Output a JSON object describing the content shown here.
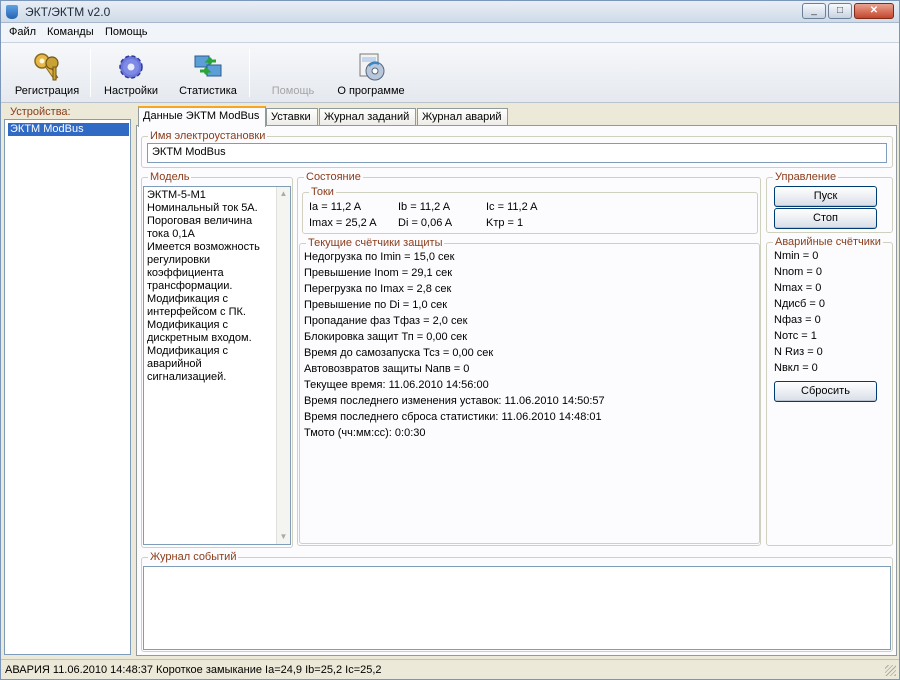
{
  "window": {
    "title": "ЭКТ/ЭКТМ v2.0"
  },
  "window_controls": {
    "minimize": "_",
    "maximize": "□",
    "close": "✕"
  },
  "menu": [
    "Файл",
    "Команды",
    "Помощь"
  ],
  "toolbar": {
    "items": [
      {
        "label": "Регистрация",
        "icon": "keys-icon",
        "enabled": true
      },
      {
        "label": "Настройки",
        "icon": "gear-icon",
        "enabled": true
      },
      {
        "label": "Статистика",
        "icon": "network-icon",
        "enabled": true
      },
      {
        "label": "Помощь",
        "icon": "help-icon",
        "enabled": false
      },
      {
        "label": "О программе",
        "icon": "about-icon",
        "enabled": true
      }
    ]
  },
  "devices": {
    "label": "Устройства:",
    "items": [
      "ЭКТМ ModBus"
    ]
  },
  "tabs": [
    "Данные ЭКТМ ModBus",
    "Уставки",
    "Журнал заданий",
    "Журнал аварий"
  ],
  "install_name": {
    "label": "Имя электроустановки",
    "value": "ЭКТМ ModBus"
  },
  "model": {
    "label": "Модель",
    "text": "ЭКТМ-5-М1\nНоминальный ток 5А.\nПороговая величина\nтока 0,1А\nИмеется возможность\nрегулировки\nкоэффициента\nтрансформации.\nМодификация с\nинтерфейсом с ПК.\nМодификация с\nдискретным входом.\nМодификация с\nаварийной\nсигнализацией."
  },
  "state": {
    "label": "Состояние",
    "currents": {
      "label": "Токи",
      "ia": "Ia = 11,2 A",
      "ib": "Ib = 11,2 A",
      "ic": "Ic = 11,2 A",
      "imax": "Imax = 25,2 A",
      "di": "Di = 0,06 A",
      "ktr": "Kтр = 1"
    },
    "counters": {
      "label": "Текущие счётчики защиты",
      "lines": [
        "Недогрузка по Imin = 15,0 сек",
        "Превышение Inom = 29,1 сек",
        "Перегрузка по Imax = 2,8 сек",
        "Превышение по Di = 1,0 сек",
        "Пропадание фаз Тфаз = 2,0 сек",
        "Блокировка защит Тп = 0,00 сек",
        "Время до самозапуска Тсз = 0,00 сек",
        "Автовозвратов защиты Nапв = 0",
        "Текущее время: 11.06.2010 14:56:00",
        "Время последнего изменения уставок: 11.06.2010 14:50:57",
        "Время последнего сброса статистики: 11.06.2010 14:48:01",
        "Тмото (чч:мм:сс): 0:0:30"
      ]
    }
  },
  "control": {
    "label": "Управление",
    "start": "Пуск",
    "stop": "Стоп"
  },
  "alarm_counters": {
    "label": "Аварийные счётчики",
    "lines": [
      "Nmin = 0",
      "Nnom = 0",
      "Nmax = 0",
      "Nдисб = 0",
      "Nфаз = 0",
      "Nотс = 1",
      "N Rиз = 0",
      "Nвкл = 0"
    ],
    "reset": "Сбросить"
  },
  "event_log": {
    "label": "Журнал событий"
  },
  "status_bar": "АВАРИЯ 11.06.2010 14:48:37 Короткое замыкание Ia=24,9 Ib=25,2 Ic=25,2"
}
